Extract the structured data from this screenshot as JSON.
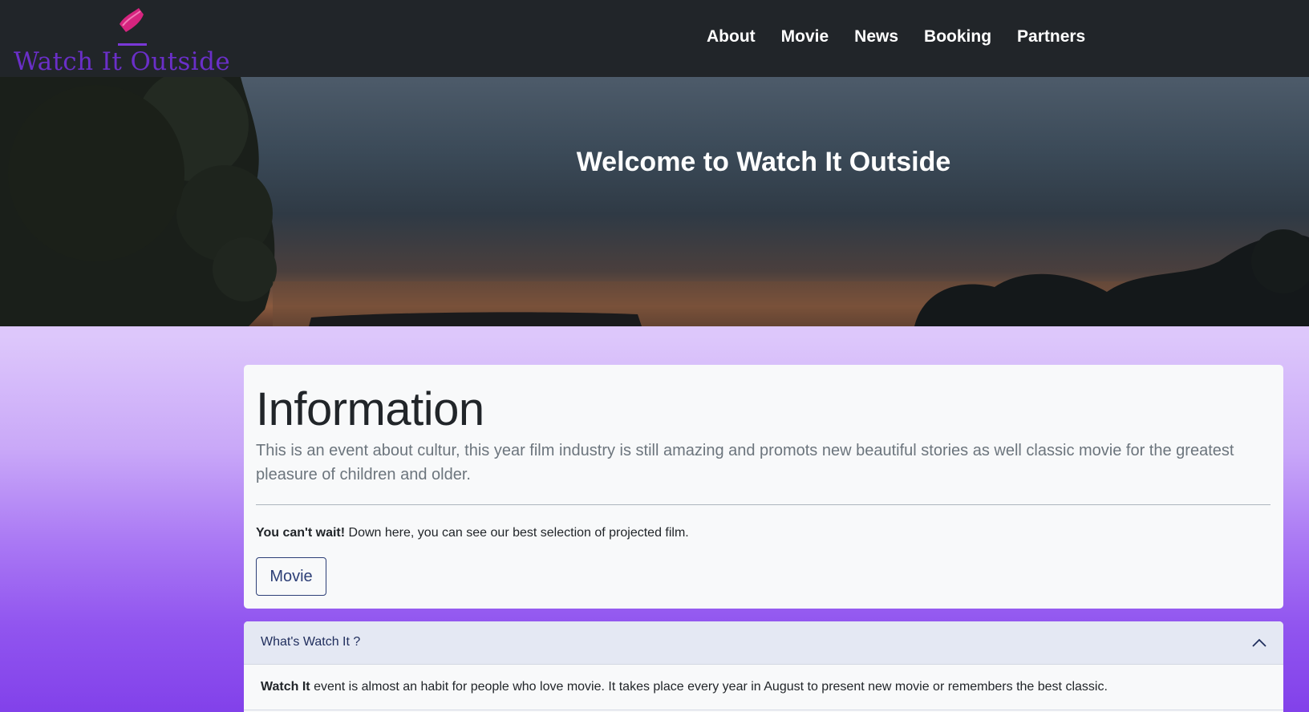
{
  "brand": {
    "name": "Watch It Outside",
    "colors": {
      "text": "#6a2fc8",
      "logo": "#d6247f"
    }
  },
  "nav": {
    "items": [
      {
        "label": "About"
      },
      {
        "label": "Movie"
      },
      {
        "label": "News"
      },
      {
        "label": "Booking"
      },
      {
        "label": "Partners"
      }
    ]
  },
  "hero": {
    "title": "Welcome to Watch It Outside"
  },
  "info": {
    "title": "Information",
    "lead": "This is an event about cultur, this year film industry is still amazing and promots new beautiful stories as well classic movie for the greatest pleasure of children and older.",
    "cta_bold": "You can't wait!",
    "cta_text": " Down here, you can see our best selection of projected film.",
    "button_label": "Movie"
  },
  "accordion": {
    "header": "What's Watch It ?",
    "icon": "chevron-up-icon",
    "body_bold": "Watch It",
    "body_text": " event is almost an habit for people who love movie. It takes place every year in August to present new movie or remembers the best classic."
  },
  "theme": {
    "navbar_bg": "#212529",
    "page_gradient_top": "#e0ccfb",
    "page_gradient_bottom": "#8241ea",
    "button_color": "#2d3f77"
  }
}
